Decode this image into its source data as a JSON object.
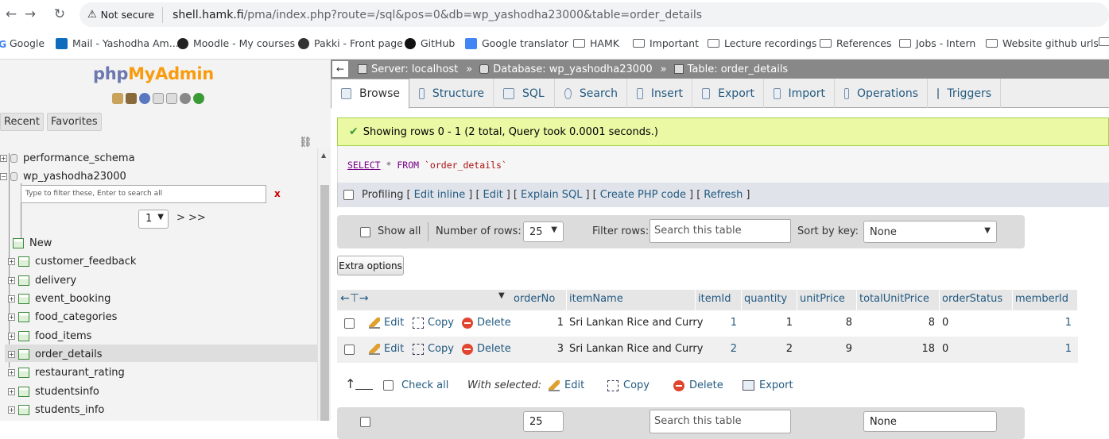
{
  "browser": {
    "security_label": "Not secure",
    "url_host": "shell.hamk.fi",
    "url_rest": "/pma/index.php?route=/sql&pos=0&db=wp_yashodha23000&table=order_details"
  },
  "bookmarks": [
    {
      "label": "Google"
    },
    {
      "label": "Mail - Yashodha Am..."
    },
    {
      "label": "Moodle - My courses"
    },
    {
      "label": "Pakki - Front page"
    },
    {
      "label": "GitHub"
    },
    {
      "label": "Google translator"
    },
    {
      "label": "HAMK"
    },
    {
      "label": "Important"
    },
    {
      "label": "Lecture recordings"
    },
    {
      "label": "References"
    },
    {
      "label": "Jobs - Intern"
    },
    {
      "label": "Website github urls"
    }
  ],
  "nav": {
    "logo_php": "php",
    "logo_myadmin": "MyAdmin",
    "tab_recent": "Recent",
    "tab_favorites": "Favorites",
    "databases": [
      {
        "name": "performance_schema"
      },
      {
        "name": "wp_yashodha23000"
      }
    ],
    "filter_placeholder": "Type to filter these, Enter to search all",
    "filter_clear": "x",
    "page_value": "1",
    "page_nav": "> >>",
    "new_label": "New",
    "tables": [
      {
        "name": "customer_feedback"
      },
      {
        "name": "delivery"
      },
      {
        "name": "event_booking"
      },
      {
        "name": "food_categories"
      },
      {
        "name": "food_items"
      },
      {
        "name": "order_details"
      },
      {
        "name": "restaurant_rating"
      },
      {
        "name": "studentsinfo"
      },
      {
        "name": "students_info"
      }
    ]
  },
  "breadcrumb": {
    "server": "Server: localhost",
    "database": "Database: wp_yashodha23000",
    "table": "Table: order_details"
  },
  "tabs": [
    {
      "label": "Browse"
    },
    {
      "label": "Structure"
    },
    {
      "label": "SQL"
    },
    {
      "label": "Search"
    },
    {
      "label": "Insert"
    },
    {
      "label": "Export"
    },
    {
      "label": "Import"
    },
    {
      "label": "Operations"
    },
    {
      "label": "Triggers"
    }
  ],
  "message": {
    "text": "Showing rows 0 - 1 (2 total, Query took 0.0001 seconds.)"
  },
  "query": {
    "select": "SELECT",
    "star": "*",
    "from": "FROM",
    "table": "`order_details`"
  },
  "profiling": {
    "label": "Profiling",
    "links": [
      "Edit inline",
      "Edit",
      "Explain SQL",
      "Create PHP code",
      "Refresh"
    ]
  },
  "table_nav": {
    "show_all": "Show all",
    "rows_label": "Number of rows:",
    "rows_value": "25",
    "filter_label": "Filter rows:",
    "filter_placeholder": "Search this table",
    "sort_label": "Sort by key:",
    "sort_value": "None"
  },
  "extra_options": "Extra options",
  "columns": [
    "orderNo",
    "itemName",
    "itemId",
    "quantity",
    "unitPrice",
    "totalUnitPrice",
    "orderStatus",
    "memberId"
  ],
  "row_actions": {
    "edit": "Edit",
    "copy": "Copy",
    "delete": "Delete"
  },
  "rows": [
    {
      "orderNo": "1",
      "itemName": "Sri Lankan Rice and Curry",
      "itemId": "1",
      "quantity": "1",
      "unitPrice": "8",
      "totalUnitPrice": "8",
      "orderStatus": "0",
      "memberId": "1"
    },
    {
      "orderNo": "3",
      "itemName": "Sri Lankan Rice and Curry",
      "itemId": "2",
      "quantity": "2",
      "unitPrice": "9",
      "totalUnitPrice": "18",
      "orderStatus": "0",
      "memberId": "1"
    }
  ],
  "bulk": {
    "check_all": "Check all",
    "with_selected": "With selected:",
    "edit": "Edit",
    "copy": "Copy",
    "delete": "Delete",
    "export": "Export"
  },
  "colors": {
    "link": "#235a81",
    "success_bg": "#ebf8a4",
    "logo_php": "#6c78af",
    "logo_myadmin": "#f89c0e"
  }
}
